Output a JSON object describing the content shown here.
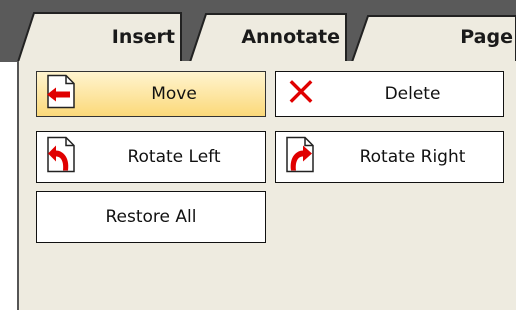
{
  "tabs": [
    {
      "label": "Insert"
    },
    {
      "label": "Annotate"
    },
    {
      "label": "Page"
    }
  ],
  "actions": {
    "move": "Move",
    "delete": "Delete",
    "rotate_left": "Rotate Left",
    "rotate_right": "Rotate Right",
    "restore_all": "Restore All"
  },
  "icons": {
    "move": "page-arrow-left-icon",
    "delete": "red-x-icon",
    "rotate_left": "page-rotate-left-icon",
    "rotate_right": "page-rotate-right-icon"
  },
  "colors": {
    "accent_red": "#e00000",
    "panel_bg": "#eeebe0",
    "tab_bar_bg": "#5a5a5a",
    "active_button": "#fbd97a"
  }
}
